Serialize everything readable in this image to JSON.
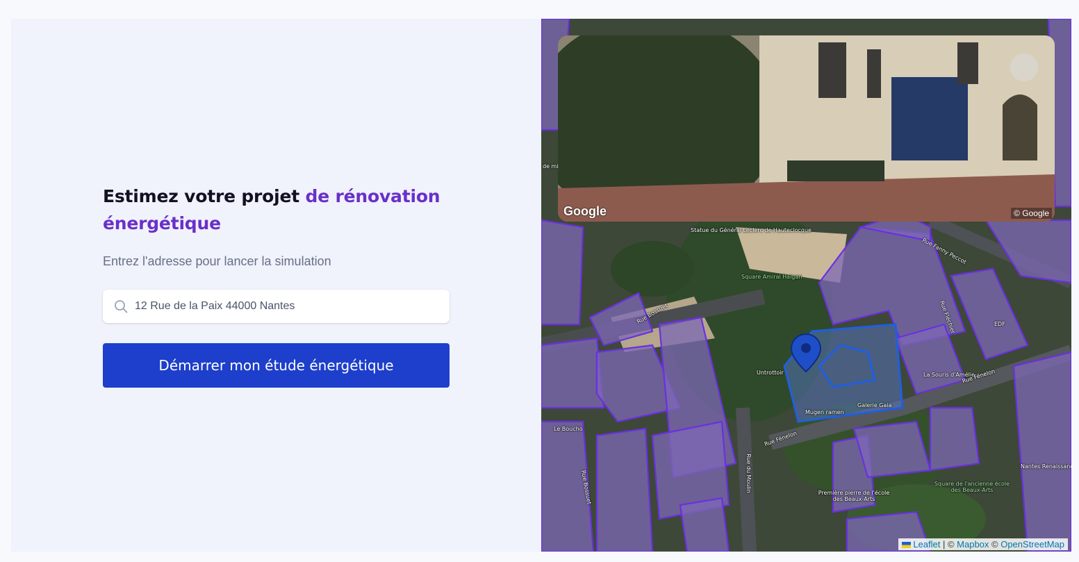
{
  "hero": {
    "title_part1": "Estimez votre projet ",
    "title_accent": "de rénovation énergétique",
    "subtitle": "Entrez l'adresse pour lancer la simulation",
    "accent_color": "#6a30c8"
  },
  "search": {
    "icon": "search-icon",
    "value": "12 Rue de la Paix 44000 Nantes",
    "placeholder": "12 Rue de la Paix 44000 Nantes"
  },
  "cta": {
    "label": "Démarrer mon étude énergétique",
    "color": "#1d3fcb"
  },
  "street_view": {
    "brand": "Google",
    "copyright": "© Google"
  },
  "map": {
    "labels": [
      "Statue du Général Leclerc de Hauteclocque",
      "Square Amiral Halgan",
      "Rue Fanny Peccot",
      "Rue Bossuet",
      "Rue Fléchier",
      "Untrottoir",
      "La Souris d'Amélie",
      "Rue Fénelon",
      "Mugen ramen",
      "Galerie Gaia",
      "Le Boucho",
      "Rue Fénelon",
      "Rue du Moulin",
      "Rue du Moulin",
      "Rue Bossuet",
      "Première pierre de l'école des Beaux-Arts",
      "Square de l'ancienne école des Beaux-Arts",
      "Nantes Renaissance",
      "EDF",
      "de mi"
    ],
    "building_color": "#7b5fd6",
    "selected_color": "#1f5fe0",
    "marker": "map-pin-icon"
  },
  "attribution": {
    "leaflet": "Leaflet",
    "sep1": " | © ",
    "mapbox": "Mapbox",
    "sep2": " © ",
    "osm": "OpenStreetMap"
  }
}
